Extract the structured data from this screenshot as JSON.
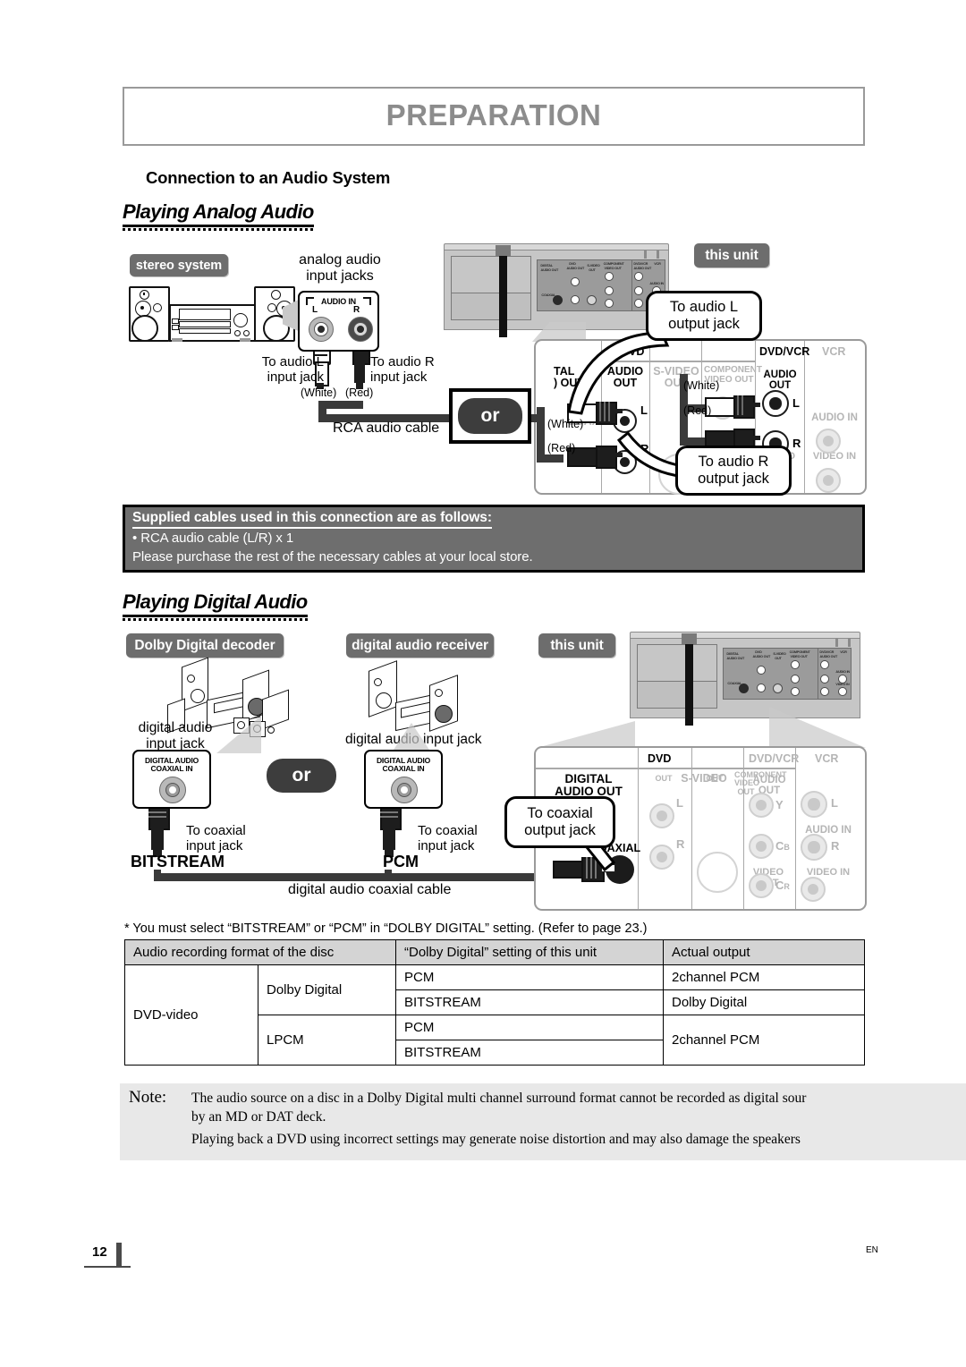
{
  "header": {
    "title": "PREPARATION"
  },
  "section": {
    "title": "Connection to an Audio System",
    "analog_heading": "Playing Analog Audio",
    "digital_heading": "Playing Digital Audio"
  },
  "analog": {
    "pill_stereo": "stereo system",
    "pill_this_unit": "this unit",
    "label_analog_jacks": "analog audio\ninput jacks",
    "jackbox_caption": "AUDIO IN",
    "jack_l": "L",
    "jack_r": "R",
    "to_audio_l_input": "To audio L\ninput jack",
    "to_audio_r_input": "To audio R\ninput jack",
    "white": "(White)",
    "red": "(Red)",
    "rca_cable": "RCA audio cable",
    "or": "or",
    "bubble_l": "To audio L\noutput jack",
    "bubble_r": "To audio R\noutput jack",
    "panel": {
      "hdr_dvd": "DVD",
      "hdr_dvdvcr": "DVD/VCR",
      "hdr_vcr": "VCR",
      "col_digital": "TAL\n) OUT",
      "col_coaxial": "COAXIAL",
      "col_audio_out": "AUDIO\nOUT",
      "col_svideo": "S-VIDEO\nOUT",
      "col_component": "COMPONENT\nVIDEO OUT",
      "col_audio_out2": "AUDIO OUT",
      "col_audio_in": "AUDIO IN",
      "col_video_out": "VIDEO OUT",
      "col_video_in": "VIDEO IN",
      "l": "L",
      "r": "R"
    }
  },
  "supplied": {
    "title": "Supplied cables used in this connection are as follows:",
    "item": "• RCA audio cable (L/R) x 1",
    "note": "Please purchase the rest of the necessary cables at your local store."
  },
  "digital": {
    "pill_decoder": "Dolby Digital decoder",
    "pill_receiver": "digital audio receiver",
    "pill_this_unit": "this unit",
    "label_input_jack_1": "digital audio\ninput jack",
    "label_input_jack_2": "digital audio input jack",
    "jackbox_caption": "DIGITAL AUDIO\nCOAXIAL IN",
    "to_coaxial_input": "To coaxial\ninput jack",
    "bitstream": "BITSTREAM",
    "pcm": "PCM",
    "or": "or",
    "cable_label": "digital audio coaxial cable",
    "bubble_coaxial": "To coaxial\noutput jack",
    "panel": {
      "hdr_dvd": "DVD",
      "hdr_dvdvcr": "DVD/VCR",
      "hdr_vcr": "VCR",
      "digital_audio_out": "DIGITAL\nAUDIO OUT",
      "coaxial": "COAXIAL",
      "svideo": "S-VIDEO",
      "out1": "OUT",
      "out2": "OUT",
      "component": "COMPONENT\nVIDEO OUT",
      "audio_out": "AUDIO OUT",
      "audio_in": "AUDIO IN",
      "video_out": "VIDEO OUT",
      "video_in": "VIDEO IN",
      "l": "L",
      "r": "R",
      "y": "Y",
      "cb": "C",
      "cb_sub": "B",
      "cr": "C",
      "cr_sub": "R"
    }
  },
  "refnote": "* You must select “BITSTREAM” or “PCM” in “DOLBY DIGITAL” setting. (Refer to page 23.)",
  "table": {
    "headers": [
      "Audio recording format of the disc",
      "“Dolby Digital” setting of this unit",
      "Actual output"
    ],
    "disc_type": "DVD-video",
    "groups": [
      {
        "format": "Dolby Digital",
        "rows": [
          {
            "setting": "PCM",
            "output": "2channel PCM"
          },
          {
            "setting": "BITSTREAM",
            "output": "Dolby Digital"
          }
        ]
      },
      {
        "format": "LPCM",
        "rows": [
          {
            "setting": "PCM",
            "output": "2channel PCM"
          },
          {
            "setting": "BITSTREAM",
            "output": ""
          }
        ],
        "merged_output": "2channel PCM"
      }
    ]
  },
  "note": {
    "label": "Note:",
    "lines": [
      "The audio source on a disc in a Dolby Digital multi channel surround format cannot be recorded as digital sour",
      "by an MD or DAT deck.",
      "Playing back a DVD using incorrect settings may generate noise distortion and may also damage the speakers"
    ]
  },
  "footer": {
    "page": "12",
    "lang": "EN"
  }
}
